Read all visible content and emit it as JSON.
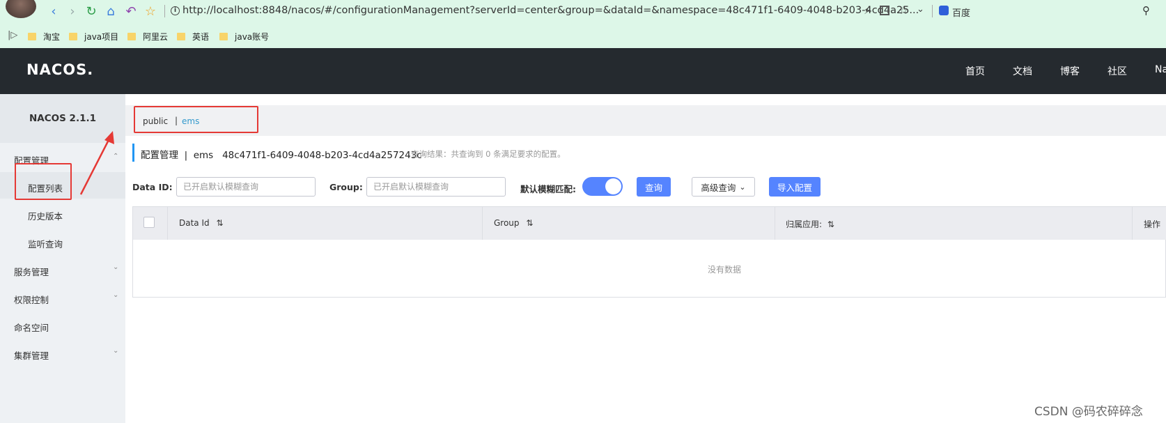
{
  "browser": {
    "url": "http://localhost:8848/nacos/#/configurationManagement?serverId=center&group=&dataId=&namespace=48c471f1-6409-4048-b203-4cd4a25...",
    "search_engine": "百度",
    "bookmarks": [
      "淘宝",
      "java项目",
      "阿里云",
      "英语",
      "java账号"
    ]
  },
  "header": {
    "logo": "NACOS.",
    "nav": [
      "首页",
      "文档",
      "博客",
      "社区",
      "Na"
    ]
  },
  "sidebar": {
    "version": "NACOS 2.1.1",
    "groups": [
      {
        "label": "配置管理",
        "items": [
          "配置列表",
          "历史版本",
          "监听查询"
        ]
      },
      {
        "label": "服务管理"
      },
      {
        "label": "权限控制"
      },
      {
        "label": "命名空间"
      },
      {
        "label": "集群管理"
      }
    ]
  },
  "namespace_bar": {
    "items": [
      "public",
      "ems"
    ],
    "separator": "|"
  },
  "page": {
    "title": "配置管理  |  ems   48c471f1-6409-4048-b203-4cd4a257243c",
    "query_result": "查询结果：共查询到 0 条满足要求的配置。"
  },
  "filters": {
    "data_id_label": "Data ID:",
    "data_id_placeholder": "已开启默认模糊查询",
    "group_label": "Group:",
    "group_placeholder": "已开启默认模糊查询",
    "fuzzy_label": "默认模糊匹配:",
    "fuzzy_on": true,
    "search_button": "查询",
    "advanced_button": "高级查询",
    "import_button": "导入配置"
  },
  "table": {
    "columns": [
      "Data Id",
      "Group",
      "归属应用:",
      "操作"
    ],
    "empty_text": "没有数据"
  },
  "watermark": "CSDN @码农碎碎念",
  "colors": {
    "accent": "#5584ff",
    "annotation": "#e53935",
    "header_bg": "#252a2f"
  }
}
